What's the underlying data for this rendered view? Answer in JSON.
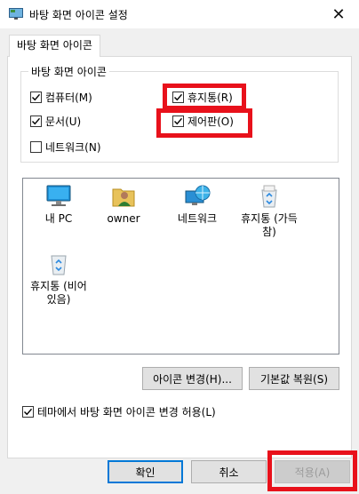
{
  "window": {
    "title": "바탕 화면 아이콘 설정",
    "close_glyph": "✕"
  },
  "tab": {
    "label": "바탕 화면 아이콘"
  },
  "group": {
    "title": "바탕 화면 아이콘",
    "checkboxes": [
      {
        "label": "컴퓨터(M)",
        "checked": true
      },
      {
        "label": "휴지통(R)",
        "checked": true
      },
      {
        "label": "문서(U)",
        "checked": true
      },
      {
        "label": "제어판(O)",
        "checked": true
      },
      {
        "label": "네트워크(N)",
        "checked": false
      }
    ]
  },
  "icons": [
    {
      "label": "내 PC",
      "icon": "computer-icon"
    },
    {
      "label": "owner",
      "icon": "user-folder-icon"
    },
    {
      "label": "네트워크",
      "icon": "network-icon"
    },
    {
      "label": "휴지통 (가득\n참)",
      "icon": "recycle-bin-full-icon"
    },
    {
      "label": "휴지통 (비어\n있음)",
      "icon": "recycle-bin-empty-icon"
    }
  ],
  "buttons": {
    "change_icon": "아이콘 변경(H)...",
    "restore_default": "기본값 복원(S)",
    "ok": "확인",
    "cancel": "취소",
    "apply": "적용(A)"
  },
  "theme_option": {
    "label": "테마에서 바탕 화면 아이콘 변경 허용(L)",
    "checked": true
  },
  "highlight_color": "#e8111b"
}
